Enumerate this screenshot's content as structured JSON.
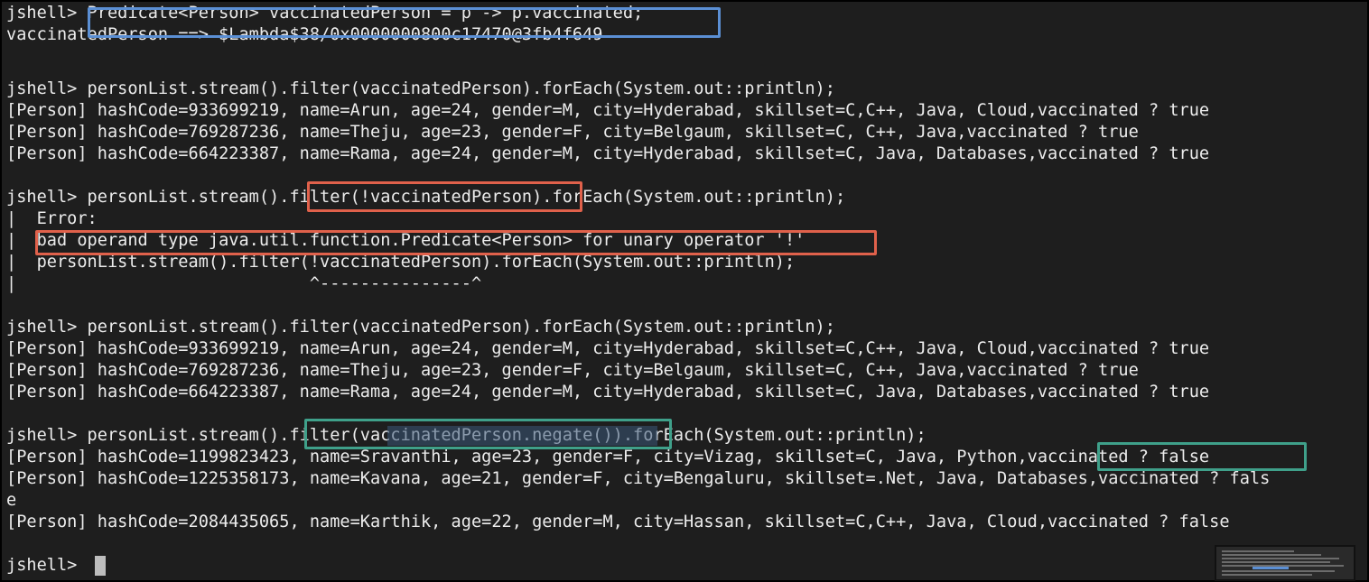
{
  "terminal": {
    "lines": [
      "jshell> Predicate<Person> vaccinatedPerson = p -> p.vaccinated;",
      "vaccinatedPerson ==> $Lambda$38/0x0000000800c17470@3fb4f649",
      "",
      "jshell> personList.stream().filter(vaccinatedPerson).forEach(System.out::println);",
      "[Person] hashCode=933699219, name=Arun, age=24, gender=M, city=Hyderabad, skillset=C,C++, Java, Cloud,vaccinated ? true",
      "[Person] hashCode=769287236, name=Theju, age=23, gender=F, city=Belgaum, skillset=C, C++, Java,vaccinated ? true",
      "[Person] hashCode=664223387, name=Rama, age=24, gender=M, city=Hyderabad, skillset=C, Java, Databases,vaccinated ? true",
      "",
      "jshell> personList.stream().filter(!vaccinatedPerson).forEach(System.out::println);",
      "|  Error:",
      "|  bad operand type java.util.function.Predicate<Person> for unary operator '!'",
      "|  personList.stream().filter(!vaccinatedPerson).forEach(System.out::println);",
      "|                             ^---------------^",
      "",
      "jshell> personList.stream().filter(vaccinatedPerson).forEach(System.out::println);",
      "[Person] hashCode=933699219, name=Arun, age=24, gender=M, city=Hyderabad, skillset=C,C++, Java, Cloud,vaccinated ? true",
      "[Person] hashCode=769287236, name=Theju, age=23, gender=F, city=Belgaum, skillset=C, C++, Java,vaccinated ? true",
      "[Person] hashCode=664223387, name=Rama, age=24, gender=M, city=Hyderabad, skillset=C, Java, Databases,vaccinated ? true",
      "",
      "jshell> personList.stream().filter(vaccinatedPerson.negate()).forEach(System.out::println);",
      "[Person] hashCode=1199823423, name=Sravanthi, age=23, gender=F, city=Vizag, skillset=C, Java, Python,vaccinated ? false",
      "[Person] hashCode=1225358173, name=Kavana, age=21, gender=F, city=Bengaluru, skillset=.Net, Java, Databases,vaccinated ? fals",
      "e",
      "[Person] hashCode=2084435065, name=Karthik, age=22, gender=M, city=Hassan, skillset=C,C++, Java, Cloud,vaccinated ? false",
      "",
      "jshell> "
    ],
    "colors": {
      "background": "#1e1e1e",
      "text": "#ececec",
      "highlight_blue": "#5b8fd4",
      "highlight_red": "#e0614b",
      "highlight_teal": "#3fa08a",
      "selection": "#3b5778"
    }
  }
}
